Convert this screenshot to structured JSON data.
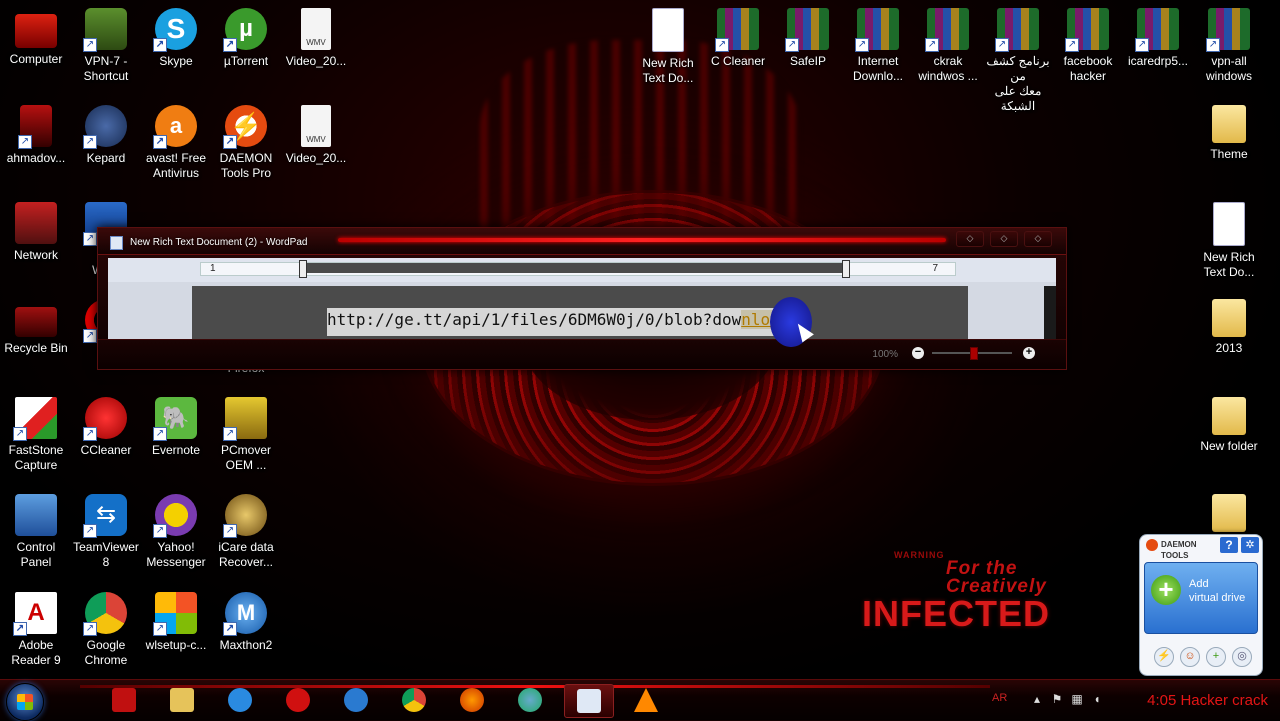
{
  "desktop": {
    "icons_left": [
      {
        "label": "Computer",
        "kind": "computer"
      },
      {
        "label": "VPN-7 -\nShortcut",
        "kind": "vpn"
      },
      {
        "label": "Skype",
        "kind": "skype",
        "glyph": "S"
      },
      {
        "label": "µTorrent",
        "kind": "utorrent",
        "glyph": "µ"
      },
      {
        "label": "Video_20...",
        "kind": "video",
        "glyph": "WMV"
      },
      {
        "label": "ahmadov...",
        "kind": "ahmad"
      },
      {
        "label": "Kepard",
        "kind": "kepard"
      },
      {
        "label": "avast! Free\nAntivirus",
        "kind": "avast",
        "glyph": "a"
      },
      {
        "label": "DAEMON\nTools Pro",
        "kind": "daemon",
        "glyph": "⚡"
      },
      {
        "label": "Video_20...",
        "kind": "video",
        "glyph": "WMV"
      },
      {
        "label": "Network",
        "kind": "network"
      },
      {
        "label": "VM\nWork",
        "kind": "vmware"
      },
      {
        "label": "Recycle Bin",
        "kind": "recycle"
      },
      {
        "label": "Op",
        "kind": "opera"
      },
      {
        "label": "Firefox",
        "kind": "firefox"
      },
      {
        "label": "FastStone\nCapture",
        "kind": "faststone"
      },
      {
        "label": "CCleaner",
        "kind": "ccleaner"
      },
      {
        "label": "Evernote",
        "kind": "evernote",
        "glyph": "🐘"
      },
      {
        "label": "PCmover\nOEM ...",
        "kind": "pcmover"
      },
      {
        "label": "Control\nPanel",
        "kind": "control"
      },
      {
        "label": "TeamViewer\n8",
        "kind": "teamviewer",
        "glyph": "⇆"
      },
      {
        "label": "Yahoo!\nMessenger",
        "kind": "yahoo"
      },
      {
        "label": "iCare data\nRecover...",
        "kind": "icare"
      },
      {
        "label": "Adobe\nReader 9",
        "kind": "adobe",
        "glyph": "A"
      },
      {
        "label": "Google\nChrome",
        "kind": "chrome"
      },
      {
        "label": "wlsetup-c...",
        "kind": "wlsetup"
      },
      {
        "label": "Maxthon2",
        "kind": "maxthon",
        "glyph": "M"
      }
    ],
    "icons_right": [
      {
        "label": "New Rich\nText Do...",
        "kind": "doc"
      },
      {
        "label": "C Cleaner",
        "kind": "rar"
      },
      {
        "label": "SafeIP",
        "kind": "rar"
      },
      {
        "label": "Internet\nDownlo...",
        "kind": "rar"
      },
      {
        "label": "ckrak\nwindwos ...",
        "kind": "rar"
      },
      {
        "label": "برنامج كشف من\nمعك على الشبكة",
        "kind": "rar"
      },
      {
        "label": "facebook\nhacker",
        "kind": "rar"
      },
      {
        "label": "icaredrp5...",
        "kind": "rar"
      },
      {
        "label": "vpn-all\nwindows",
        "kind": "rar"
      },
      {
        "label": "Theme",
        "kind": "folder"
      },
      {
        "label": "New Rich\nText Do...",
        "kind": "doc"
      },
      {
        "label": "2013",
        "kind": "folder"
      },
      {
        "label": "New folder",
        "kind": "folder"
      },
      {
        "label": "",
        "kind": "folder"
      }
    ],
    "wallpaper": {
      "warning": "WARNING",
      "line1": "For the",
      "line2": "Creatively",
      "line3": "INFECTED"
    }
  },
  "wordpad": {
    "title": "New Rich Text Document (2) - WordPad",
    "ruler_start": "1",
    "ruler_end": "7",
    "url_main": "http://ge.tt/api/1/files/6DM6W0j/0/blob?dow",
    "url_selected": "nload",
    "zoom": "100%",
    "zoom_minus": "−",
    "zoom_plus": "+"
  },
  "daemon_widget": {
    "brand_line1": "DAEMON",
    "brand_line2": "TOOLS",
    "help": "?",
    "add_label_line1": "Add",
    "add_label_line2": "virtual drive"
  },
  "taskbar": {
    "items": [
      "sa",
      "explorer",
      "ie",
      "opera",
      "maxthon",
      "chrome",
      "firefox",
      "network",
      "wordpad",
      "vlc"
    ],
    "lang": "AR",
    "clock": "4:05 Hacker crack"
  },
  "colors": {
    "accent": "#e31515",
    "taskbar_bg": "#0d0000"
  }
}
